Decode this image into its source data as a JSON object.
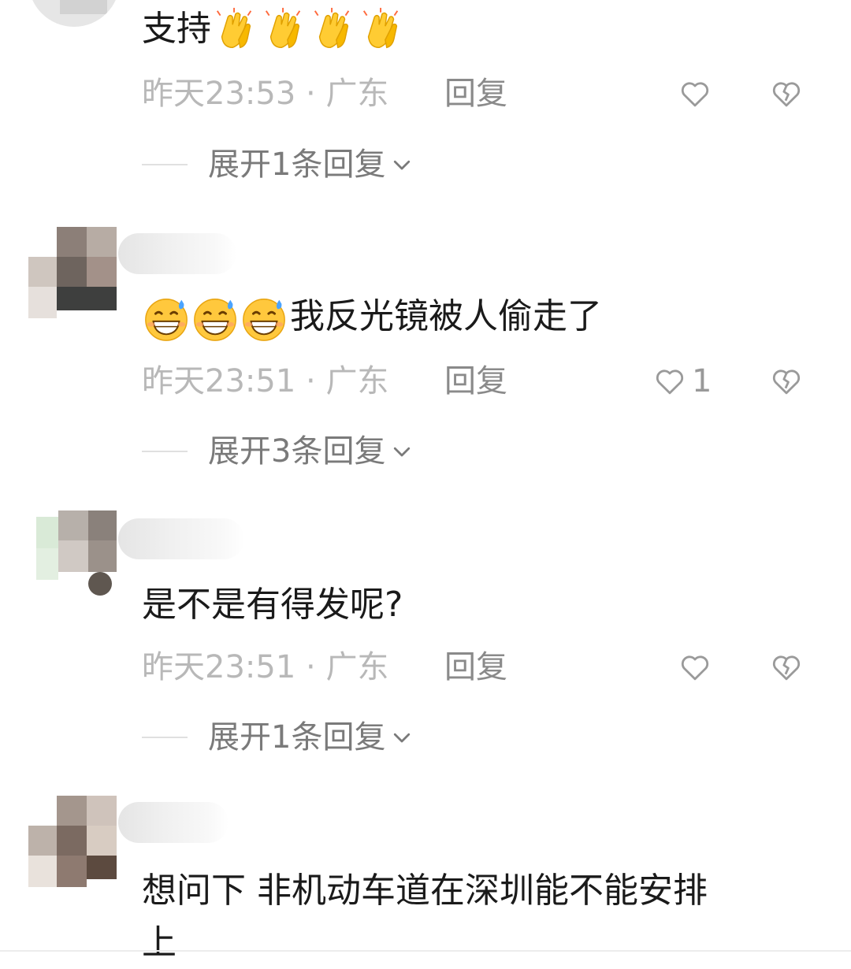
{
  "comments": [
    {
      "text": "支持",
      "emoji": [
        "clapping-hands-icon",
        "clapping-hands-icon",
        "clapping-hands-icon",
        "clapping-hands-icon"
      ],
      "emoji_position": "after",
      "time": "昨天23:53",
      "separator": " · ",
      "location": "广东",
      "reply_label": "回复",
      "likes": "",
      "expand_label": "展开1条回复"
    },
    {
      "text": "我反光镜被人偷走了",
      "emoji": [
        "grinning-sweat-icon",
        "grinning-sweat-icon",
        "grinning-sweat-icon"
      ],
      "emoji_position": "before",
      "time": "昨天23:51",
      "separator": " · ",
      "location": "广东",
      "reply_label": "回复",
      "likes": "1",
      "expand_label": "展开3条回复"
    },
    {
      "text": "是不是有得发呢?",
      "emoji": [],
      "time": "昨天23:51",
      "separator": " · ",
      "location": "广东",
      "reply_label": "回复",
      "likes": "",
      "expand_label": "展开1条回复"
    },
    {
      "text": "想问下 非机动车道在深圳能不能安排",
      "text_line2": "上",
      "emoji": []
    }
  ],
  "colors": {
    "text": "#1a1a1a",
    "meta": "#b8b8b8",
    "reply": "#8a8a8a",
    "emoji_yellow": "#ffc83d"
  }
}
